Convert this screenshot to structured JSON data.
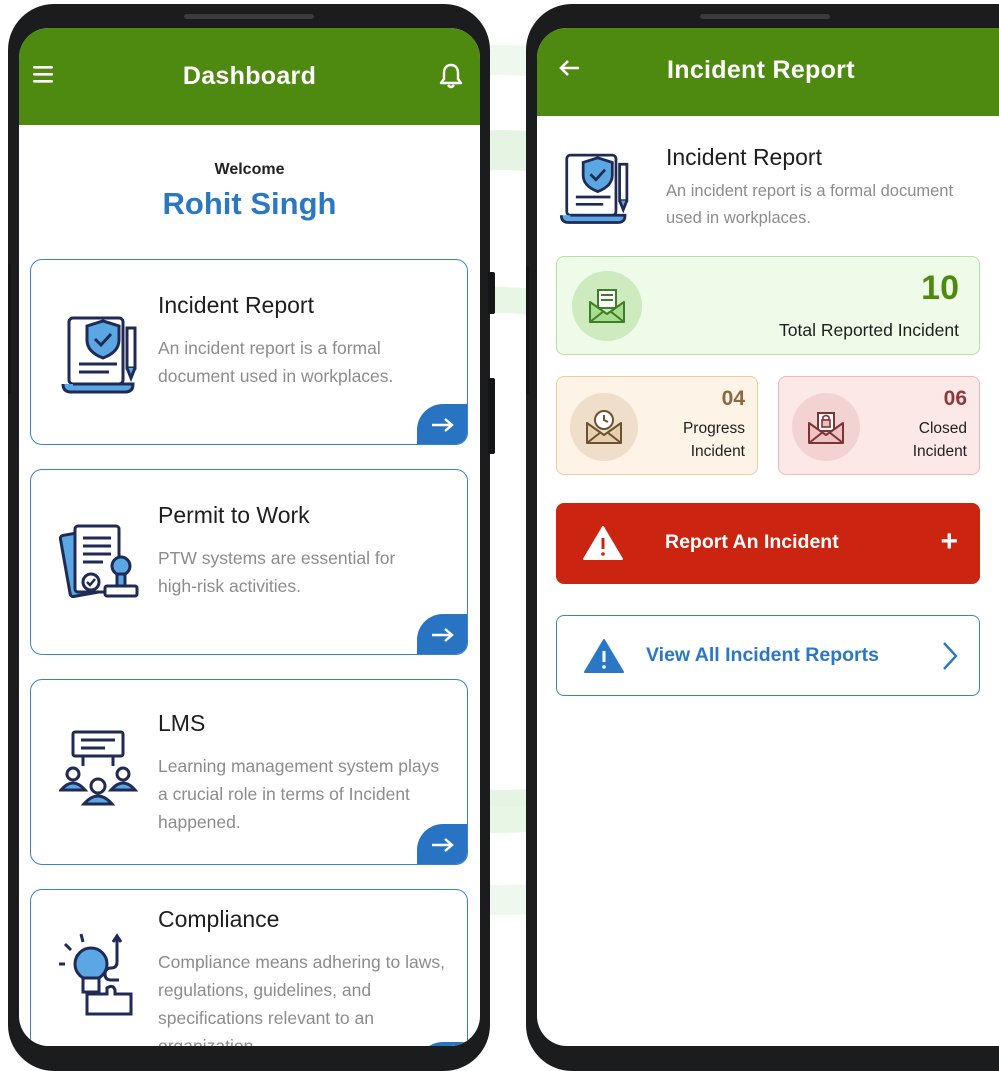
{
  "colors": {
    "brand_green": "#4e8a0f",
    "accent_blue": "#2a78c4",
    "danger_red": "#cb2410"
  },
  "dashboard": {
    "title": "Dashboard",
    "menu_icon": "hamburger-menu-icon",
    "notification_icon": "bell-icon",
    "welcome_label": "Welcome",
    "user_name": "Rohit Singh",
    "cards": [
      {
        "title": "Incident Report",
        "description": "An incident report is a formal document used in workplaces.",
        "icon": "incident-document-icon",
        "action_icon": "arrow-right-icon"
      },
      {
        "title": "Permit to Work",
        "description": "PTW systems are essential for high-risk activities.",
        "icon": "permit-stamp-icon",
        "action_icon": "arrow-right-icon"
      },
      {
        "title": "LMS",
        "description": "Learning management system plays a crucial role in terms of Incident happened.",
        "icon": "training-group-icon",
        "action_icon": "arrow-right-icon"
      },
      {
        "title": "Compliance",
        "description": "Compliance means adhering to laws, regulations, guidelines, and specifications relevant to an organization.",
        "icon": "lightbulb-puzzle-icon",
        "action_icon": "arrow-right-icon"
      }
    ]
  },
  "incident_screen": {
    "title": "Incident Report",
    "back_icon": "arrow-left-icon",
    "header": {
      "title": "Incident Report",
      "description": "An incident report is a formal document used in workplaces.",
      "icon": "incident-document-icon"
    },
    "stats": {
      "total": {
        "value": "10",
        "label": "Total Reported Incident",
        "icon": "mail-document-icon"
      },
      "progress": {
        "value": "04",
        "label_line1": "Progress",
        "label_line2": "Incident",
        "icon": "mail-clock-icon"
      },
      "closed": {
        "value": "06",
        "label_line1": "Closed",
        "label_line2": "Incident",
        "icon": "mail-lock-icon"
      }
    },
    "report_button": {
      "label": "Report An Incident",
      "icon": "warning-triangle-icon",
      "trailing": "+"
    },
    "view_button": {
      "label": "View All Incident Reports",
      "icon": "warning-triangle-icon",
      "trailing_icon": "chevron-right-icon"
    }
  }
}
